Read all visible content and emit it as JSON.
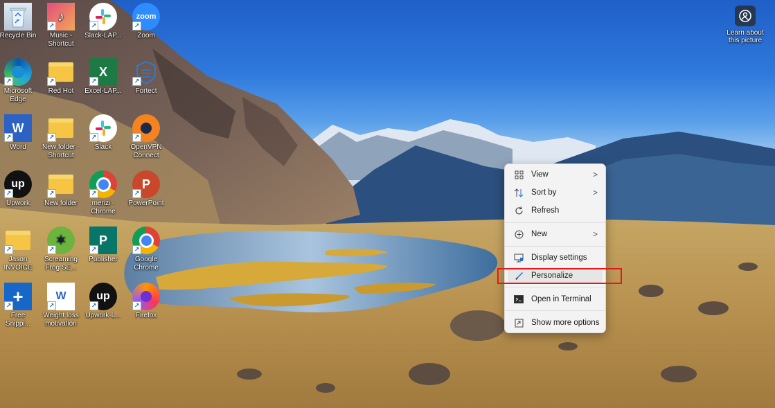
{
  "desktop": {
    "icons": [
      {
        "label": "Recycle Bin",
        "icon": "recycle-bin-icon"
      },
      {
        "label": "Music -\nShortcut",
        "icon": "music-icon"
      },
      {
        "label": "Slack-LAP...",
        "icon": "slack-icon"
      },
      {
        "label": "Zoom",
        "icon": "zoom-icon",
        "glyph": "zoom"
      },
      {
        "label": "Microsoft\nEdge",
        "icon": "edge-icon"
      },
      {
        "label": "Red Hot",
        "icon": "folder-icon"
      },
      {
        "label": "Excel-LAP...",
        "icon": "excel-icon",
        "glyph": "X"
      },
      {
        "label": "Fortect",
        "icon": "fortect-icon"
      },
      {
        "label": "Word",
        "icon": "word-icon",
        "glyph": "W"
      },
      {
        "label": "New folder -\nShortcut",
        "icon": "folder-icon"
      },
      {
        "label": "Slack",
        "icon": "slack-icon"
      },
      {
        "label": "OpenVPN\nConnect",
        "icon": "openvpn-icon"
      },
      {
        "label": "Upwork",
        "icon": "upwork-icon",
        "glyph": "up"
      },
      {
        "label": "New folder",
        "icon": "folder-icon"
      },
      {
        "label": "menzi -\nChrome",
        "icon": "chrome-icon"
      },
      {
        "label": "PowerPoint",
        "icon": "powerpoint-icon",
        "glyph": "P"
      },
      {
        "label": "Jason\nINVOICE",
        "icon": "folder-icon"
      },
      {
        "label": "Screaming\nFrog SE...",
        "icon": "screaming-frog-icon"
      },
      {
        "label": "Publisher",
        "icon": "publisher-icon",
        "glyph": "P"
      },
      {
        "label": "Google\nChrome",
        "icon": "chrome-icon"
      },
      {
        "label": "Free\nSnippi...",
        "icon": "free-snipping-icon",
        "glyph": "+"
      },
      {
        "label": "Weight loss\nmotivation",
        "icon": "word-document-icon",
        "glyph": "W"
      },
      {
        "label": "Upwork-L...",
        "icon": "upwork-icon",
        "glyph": "up"
      },
      {
        "label": "Firefox",
        "icon": "firefox-icon"
      }
    ],
    "learn_about": "Learn about\nthis picture"
  },
  "context_menu": {
    "items": [
      {
        "label": "View",
        "icon": "grid-view-icon",
        "submenu": ">"
      },
      {
        "label": "Sort by",
        "icon": "sort-icon",
        "submenu": ">"
      },
      {
        "label": "Refresh",
        "icon": "refresh-icon"
      },
      {
        "label": "New",
        "icon": "plus-circle-icon",
        "submenu": ">"
      },
      {
        "label": "Display settings",
        "icon": "display-icon"
      },
      {
        "label": "Personalize",
        "icon": "brush-icon"
      },
      {
        "label": "Open in Terminal",
        "icon": "terminal-icon"
      },
      {
        "label": "Show more options",
        "icon": "more-options-icon"
      }
    ],
    "highlight_color": "#e01b1b"
  }
}
